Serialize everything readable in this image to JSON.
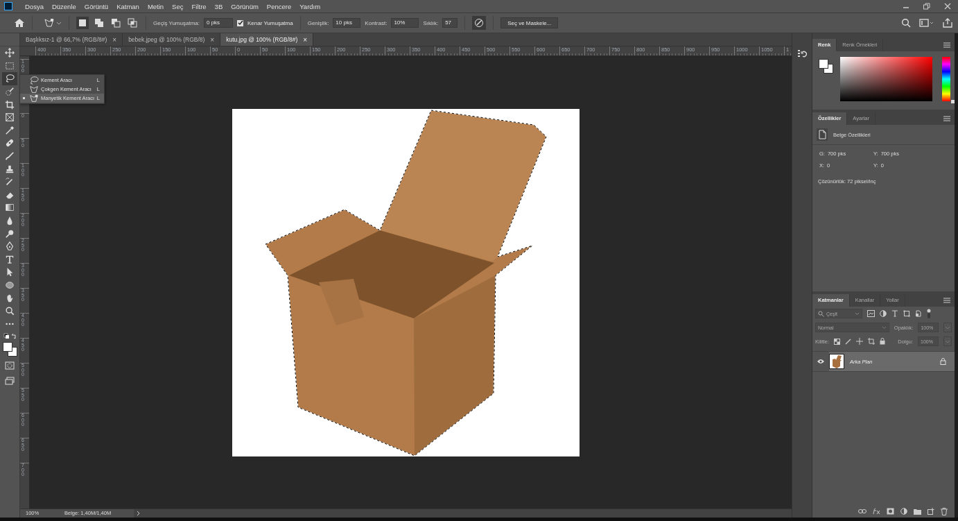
{
  "menu": [
    "Dosya",
    "Düzenle",
    "Görüntü",
    "Katman",
    "Metin",
    "Seç",
    "Filtre",
    "3B",
    "Görünüm",
    "Pencere",
    "Yardım"
  ],
  "options_bar": {
    "selection_modes": [
      {
        "selected": true
      },
      {
        "selected": false
      },
      {
        "selected": false
      },
      {
        "selected": false
      }
    ],
    "feather_label": "Geçiş Yumuşatma:",
    "feather_value": "0 pks",
    "anti_alias": {
      "label": "Kenar Yumuşatma",
      "checked": true
    },
    "width_label": "Genişlik:",
    "width_value": "10 pks",
    "contrast_label": "Kontrast:",
    "contrast_value": "10%",
    "frequency_label": "Sıklık:",
    "frequency_value": "57",
    "select_mask_button": "Seç ve Maskele..."
  },
  "document_tabs": [
    {
      "title": "Başlıksız-1 @ 66,7% (RGB/8#)",
      "close": "×",
      "selected": false
    },
    {
      "title": "bebek.jpeg @ 100% (RGB/8)",
      "close": "×",
      "selected": false
    },
    {
      "title": "kutu.jpg @ 100% (RGB/8#)",
      "close": "×",
      "selected": true
    }
  ],
  "ruler_h": [
    "400",
    "350",
    "300",
    "250",
    "200",
    "150",
    "100",
    "50",
    "0",
    "50",
    "100",
    "150",
    "200",
    "250",
    "300",
    "350",
    "400",
    "450",
    "500",
    "550",
    "600",
    "650",
    "700",
    "750",
    "800",
    "850",
    "900",
    "950",
    "1000",
    "1050",
    "1"
  ],
  "ruler_v": [
    "100",
    "0",
    "50",
    "100",
    "150",
    "200",
    "250",
    "300",
    "350",
    "400",
    "450",
    "500",
    "550",
    "600",
    "650",
    "700"
  ],
  "tools": [
    {
      "kind": "move",
      "selected": false
    },
    {
      "kind": "marquee",
      "selected": false
    },
    {
      "kind": "lasso",
      "selected": true
    },
    {
      "kind": "quick-select",
      "selected": false
    },
    {
      "kind": "crop",
      "selected": false
    },
    {
      "kind": "frame",
      "selected": false
    },
    {
      "kind": "eyedropper",
      "selected": false
    },
    {
      "kind": "healing",
      "selected": false
    },
    {
      "kind": "brush",
      "selected": false
    },
    {
      "kind": "stamp",
      "selected": false
    },
    {
      "kind": "history-brush",
      "selected": false
    },
    {
      "kind": "eraser",
      "selected": false
    },
    {
      "kind": "gradient",
      "selected": false
    },
    {
      "kind": "blur",
      "selected": false
    },
    {
      "kind": "dodge",
      "selected": false
    },
    {
      "kind": "pen",
      "selected": false
    },
    {
      "kind": "type",
      "selected": false
    },
    {
      "kind": "path-select",
      "selected": false
    },
    {
      "kind": "ellipse",
      "selected": false
    },
    {
      "kind": "hand",
      "selected": false
    },
    {
      "kind": "zoom",
      "selected": false
    },
    {
      "kind": "more",
      "selected": false
    }
  ],
  "tool_flyout": [
    {
      "label": "Kement Aracı",
      "shortcut": "L",
      "selected": false
    },
    {
      "label": "Çokgen Kement Aracı",
      "shortcut": "L",
      "selected": false
    },
    {
      "label": "Manyetik Kement Aracı",
      "shortcut": "L",
      "selected": true
    }
  ],
  "status_bar": {
    "zoom": "100%",
    "doc_info": "Belge: 1,40M/1,40M"
  },
  "color_panel": {
    "tabs": [
      {
        "label": "Renk",
        "selected": true
      },
      {
        "label": "Renk Örnekleri",
        "selected": false
      }
    ],
    "hue_slider": {
      "level": 0
    }
  },
  "properties_panel": {
    "tabs": [
      {
        "label": "Özellikler",
        "selected": true
      },
      {
        "label": "Ayarlar",
        "selected": false
      }
    ],
    "header": "Belge Özellikleri",
    "fields": [
      {
        "label": "G:",
        "value": "700 pks"
      },
      {
        "label": "Y:",
        "value": "700 pks"
      },
      {
        "label": "X:",
        "value": "0"
      },
      {
        "label": "Y:",
        "value": "0"
      }
    ],
    "resolution": "Çözünürlük: 72 piksel/inç"
  },
  "layers_panel": {
    "tabs": [
      {
        "label": "Katmanlar",
        "selected": true
      },
      {
        "label": "Kanallar",
        "selected": false
      },
      {
        "label": "Yollar",
        "selected": false
      }
    ],
    "filter_value": "Çeşit",
    "blend_mode": "Normal",
    "opacity_label": "Opaklık:",
    "opacity_value": "100%",
    "lock_label": "Kilitle:",
    "fill_label": "Dolgu:",
    "fill_value": "100%",
    "layers": [
      {
        "name": "Arka Plan",
        "visible": true,
        "locked": true,
        "selected": true
      }
    ]
  }
}
